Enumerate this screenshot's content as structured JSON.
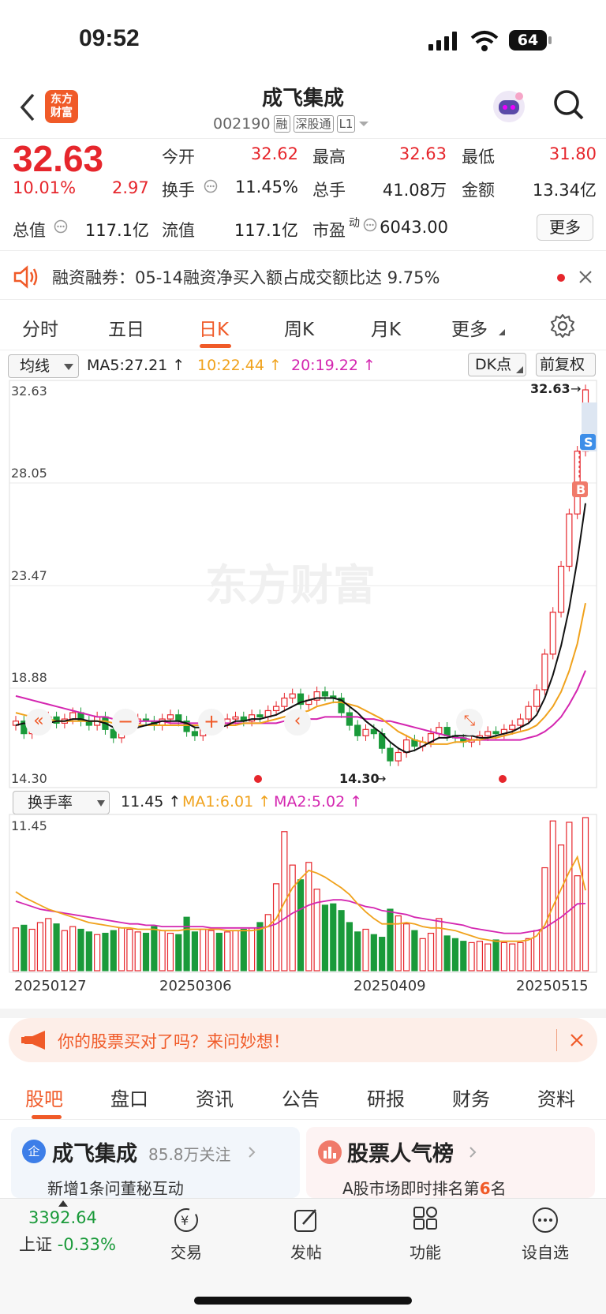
{
  "status_bar": {
    "time": "09:52",
    "battery": "64"
  },
  "header": {
    "title": "成飞集成",
    "code": "002190",
    "tags": [
      "融",
      "深股通",
      "L1"
    ],
    "logo_text": "东方财富"
  },
  "quote": {
    "price": "32.63",
    "change_pct": "10.01%",
    "change": "2.97",
    "stats": [
      {
        "label": "今开",
        "value": "32.62"
      },
      {
        "label": "最高",
        "value": "32.63"
      },
      {
        "label": "最低",
        "value": "31.80"
      },
      {
        "label": "换手",
        "value": "11.45%"
      },
      {
        "label": "总手",
        "value": "41.08万"
      },
      {
        "label": "金额",
        "value": "13.34亿"
      },
      {
        "label": "总值",
        "value": "117.1亿"
      },
      {
        "label": "流值",
        "value": "117.1亿"
      },
      {
        "label": "市盈",
        "sup": "动",
        "value": "6043.00"
      }
    ],
    "more_label": "更多"
  },
  "notice": {
    "text": "融资融券：05-14融资净买入额占成交额比达 9.75%"
  },
  "chart_tabs": [
    "分时",
    "五日",
    "日K",
    "周K",
    "月K",
    "更多"
  ],
  "chart_tabs_active": 2,
  "indicator_bar": {
    "selector": "均线",
    "ma5": "MA5:27.21",
    "ma10": "10:22.44",
    "ma20": "20:19.22",
    "dk_label": "DK点",
    "adjust_label": "前复权"
  },
  "watermark": "东方财富",
  "kline_axis": [
    "32.63",
    "28.05",
    "23.47",
    "18.88",
    "14.30"
  ],
  "kline_markers": {
    "high": "32.63",
    "low": "14.30",
    "sell": "S",
    "buy": "B"
  },
  "volume_bar": {
    "selector": "换手率",
    "value": "11.45",
    "ma1": "MA1:6.01",
    "ma2": "MA2:5.02",
    "axis_max": "11.45"
  },
  "date_axis": [
    "20250127",
    "20250306",
    "20250409",
    "20250515"
  ],
  "chart_data": {
    "type": "candlestick",
    "ylim": [
      14.3,
      32.63
    ],
    "closes": [
      16.8,
      16.2,
      16.5,
      16.9,
      17.0,
      16.7,
      16.9,
      17.2,
      16.8,
      16.6,
      17.0,
      16.4,
      16.0,
      16.5,
      16.7,
      16.9,
      16.8,
      16.6,
      16.9,
      17.1,
      16.8,
      16.3,
      16.1,
      16.6,
      16.8,
      16.7,
      16.9,
      17.0,
      16.8,
      17.1,
      17.0,
      17.3,
      17.5,
      17.9,
      18.1,
      17.6,
      17.8,
      18.2,
      18.0,
      17.9,
      17.2,
      16.6,
      16.1,
      16.4,
      16.2,
      15.5,
      14.9,
      15.3,
      15.9,
      15.6,
      15.8,
      16.2,
      16.5,
      16.1,
      16.0,
      15.8,
      15.9,
      16.1,
      16.3,
      16.2,
      16.4,
      16.6,
      16.9,
      17.5,
      18.3,
      20.0,
      22.0,
      24.2,
      26.7,
      29.7,
      32.63
    ],
    "ma5": [
      16.6,
      16.7,
      16.6,
      16.6,
      16.7,
      16.8,
      16.8,
      16.9,
      16.9,
      16.8,
      16.8,
      16.7,
      16.5,
      16.4,
      16.4,
      16.5,
      16.6,
      16.7,
      16.8,
      16.8,
      16.8,
      16.7,
      16.5,
      16.5,
      16.5,
      16.5,
      16.6,
      16.8,
      16.8,
      16.9,
      16.9,
      17.0,
      17.1,
      17.3,
      17.5,
      17.7,
      17.8,
      17.9,
      17.9,
      17.9,
      17.8,
      17.5,
      17.2,
      16.8,
      16.5,
      16.2,
      15.8,
      15.5,
      15.3,
      15.4,
      15.6,
      15.8,
      16.0,
      16.0,
      16.1,
      16.1,
      16.1,
      16.0,
      16.0,
      16.1,
      16.2,
      16.3,
      16.5,
      16.7,
      17.1,
      17.9,
      19.0,
      20.4,
      22.2,
      24.5,
      27.21
    ],
    "ma10": [
      17.2,
      17.1,
      17.0,
      16.9,
      16.9,
      16.8,
      16.8,
      16.8,
      16.8,
      16.8,
      16.8,
      16.8,
      16.7,
      16.6,
      16.6,
      16.6,
      16.6,
      16.6,
      16.6,
      16.6,
      16.6,
      16.6,
      16.6,
      16.6,
      16.6,
      16.6,
      16.6,
      16.6,
      16.7,
      16.7,
      16.7,
      16.8,
      16.9,
      17.0,
      17.1,
      17.2,
      17.3,
      17.5,
      17.6,
      17.7,
      17.7,
      17.6,
      17.5,
      17.3,
      17.1,
      16.9,
      16.6,
      16.3,
      16.1,
      15.9,
      15.8,
      15.7,
      15.7,
      15.7,
      15.8,
      15.8,
      15.9,
      15.9,
      16.0,
      16.0,
      16.1,
      16.2,
      16.3,
      16.4,
      16.6,
      17.0,
      17.5,
      18.2,
      19.2,
      20.5,
      22.44
    ],
    "ma20": [
      18.0,
      17.9,
      17.8,
      17.7,
      17.6,
      17.5,
      17.4,
      17.3,
      17.2,
      17.1,
      17.0,
      17.0,
      16.9,
      16.9,
      16.8,
      16.8,
      16.8,
      16.8,
      16.8,
      16.7,
      16.7,
      16.7,
      16.7,
      16.7,
      16.7,
      16.7,
      16.7,
      16.7,
      16.7,
      16.7,
      16.7,
      16.7,
      16.7,
      16.8,
      16.8,
      16.8,
      16.9,
      16.9,
      17.0,
      17.0,
      17.0,
      17.0,
      17.0,
      16.9,
      16.9,
      16.8,
      16.8,
      16.7,
      16.6,
      16.5,
      16.4,
      16.3,
      16.2,
      16.1,
      16.0,
      16.0,
      15.9,
      15.9,
      15.9,
      15.9,
      15.9,
      15.9,
      15.9,
      16.0,
      16.1,
      16.3,
      16.6,
      17.0,
      17.6,
      18.3,
      19.22
    ],
    "turnover": [
      3.2,
      3.4,
      3.1,
      3.6,
      3.9,
      3.5,
      3.0,
      3.3,
      3.1,
      2.9,
      2.7,
      2.8,
      3.0,
      3.2,
      3.1,
      2.9,
      2.8,
      3.3,
      3.0,
      2.8,
      2.7,
      4.0,
      2.9,
      3.1,
      3.0,
      2.8,
      2.9,
      3.0,
      3.1,
      3.2,
      3.6,
      4.2,
      6.5,
      10.4,
      7.9,
      6.8,
      8.1,
      6.1,
      4.9,
      5.0,
      4.5,
      3.6,
      2.9,
      3.1,
      2.7,
      2.5,
      4.6,
      4.1,
      3.5,
      3.0,
      2.4,
      2.8,
      3.9,
      2.6,
      2.4,
      2.2,
      2.1,
      2.2,
      2.0,
      2.3,
      2.1,
      2.0,
      2.1,
      2.4,
      3.0,
      7.7,
      11.2,
      9.4,
      11.1,
      7.1,
      11.45
    ],
    "ma1": [
      5.9,
      5.5,
      5.2,
      4.9,
      4.6,
      4.4,
      4.2,
      4.0,
      3.8,
      3.6,
      3.5,
      3.4,
      3.3,
      3.2,
      3.2,
      3.1,
      3.1,
      3.1,
      3.0,
      3.0,
      3.0,
      3.1,
      3.1,
      3.1,
      3.1,
      3.1,
      3.0,
      3.0,
      3.0,
      3.0,
      3.1,
      3.3,
      3.9,
      5.1,
      6.2,
      6.9,
      7.5,
      7.3,
      7.0,
      6.6,
      6.2,
      5.7,
      5.0,
      4.4,
      3.9,
      3.5,
      3.5,
      3.5,
      3.6,
      3.5,
      3.3,
      3.2,
      3.2,
      3.1,
      3.0,
      2.8,
      2.6,
      2.4,
      2.3,
      2.2,
      2.2,
      2.2,
      2.2,
      2.3,
      2.6,
      3.4,
      4.8,
      6.1,
      7.4,
      8.5,
      6.01
    ],
    "ma2": [
      5.2,
      5.0,
      4.8,
      4.6,
      4.5,
      4.4,
      4.3,
      4.2,
      4.1,
      4.0,
      3.9,
      3.8,
      3.7,
      3.6,
      3.5,
      3.5,
      3.4,
      3.4,
      3.3,
      3.3,
      3.3,
      3.3,
      3.3,
      3.3,
      3.2,
      3.2,
      3.2,
      3.2,
      3.2,
      3.2,
      3.2,
      3.3,
      3.5,
      3.9,
      4.3,
      4.6,
      4.9,
      5.1,
      5.2,
      5.3,
      5.3,
      5.2,
      5.0,
      4.8,
      4.7,
      4.5,
      4.4,
      4.3,
      4.2,
      4.0,
      3.9,
      3.8,
      3.7,
      3.6,
      3.5,
      3.4,
      3.2,
      3.1,
      3.0,
      2.9,
      2.8,
      2.8,
      2.8,
      2.9,
      3.0,
      3.2,
      3.6,
      4.0,
      4.5,
      5.0,
      5.02
    ]
  },
  "ad": {
    "text": "你的股票买对了吗？来问妙想！"
  },
  "info_tabs": [
    "股吧",
    "盘口",
    "资讯",
    "公告",
    "研报",
    "财务",
    "资料"
  ],
  "info_tabs_active": 0,
  "cards": [
    {
      "badge": "企",
      "title": "成飞集成",
      "sub": "85.8万关注",
      "desc": "新增1条问董秘互动"
    },
    {
      "title": "股票人气榜",
      "desc_pre": "A股市场即时排名第",
      "rank": "6",
      "desc_post": "名"
    }
  ],
  "bottom_nav": {
    "index_value": "3392.64",
    "index_label": "上证",
    "index_change": "-0.33%",
    "items": [
      "交易",
      "发帖",
      "功能",
      "设自选"
    ]
  }
}
